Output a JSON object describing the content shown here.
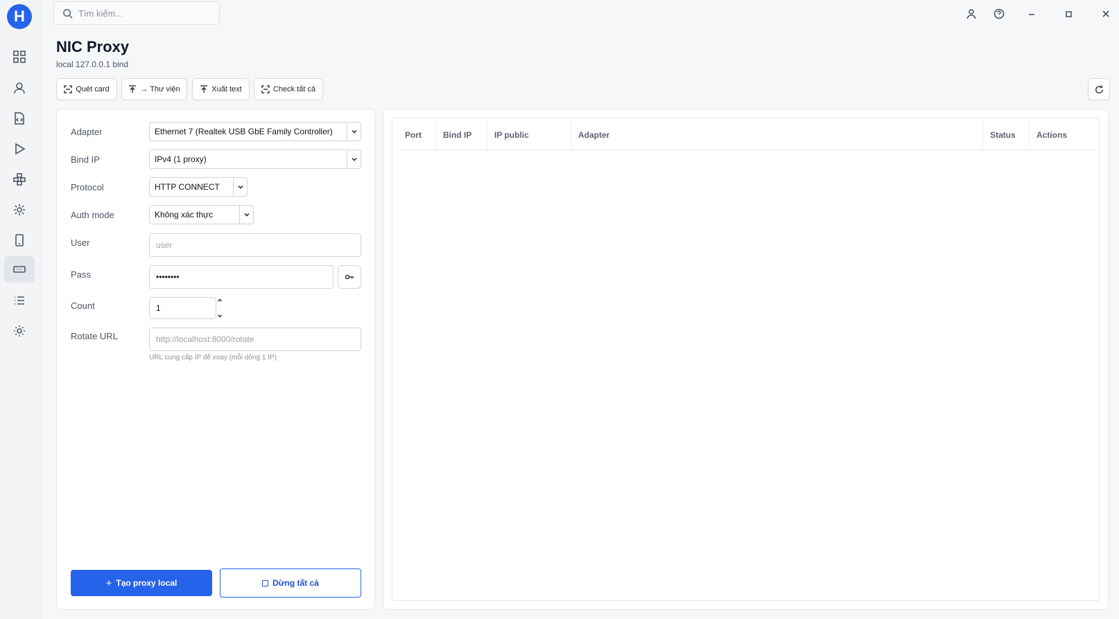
{
  "app": {
    "logo_letter": "H"
  },
  "search": {
    "placeholder": "Tìm kiếm..."
  },
  "sidebar": {
    "items": [
      {
        "icon": "dashboard-icon"
      },
      {
        "icon": "user-icon"
      },
      {
        "icon": "code-file-icon"
      },
      {
        "icon": "play-icon"
      },
      {
        "icon": "network-icon"
      },
      {
        "icon": "sun-icon"
      },
      {
        "icon": "phone-icon"
      },
      {
        "icon": "nic-card-icon",
        "active": true
      },
      {
        "icon": "list-icon"
      },
      {
        "icon": "settings-icon"
      }
    ]
  },
  "page": {
    "title": "NIC Proxy",
    "subtitle": "local 127.0.0.1 bind"
  },
  "toolbar": {
    "scan_label": "Quét card",
    "library_label": "→ Thư viện",
    "export_label": "Xuất text",
    "check_all_label": "Check tất cả"
  },
  "form": {
    "adapter_label": "Adapter",
    "adapter_value": "Ethernet 7 (Realtek USB GbE Family Controller)",
    "bind_ip_label": "Bind IP",
    "bind_ip_value": "IPv4 (1 proxy)",
    "protocol_label": "Protocol",
    "protocol_value": "HTTP CONNECT",
    "auth_mode_label": "Auth mode",
    "auth_mode_value": "Không xác thực",
    "user_label": "User",
    "user_placeholder": "user",
    "pass_label": "Pass",
    "pass_value": "••••••••",
    "count_label": "Count",
    "count_value": "1",
    "rotate_label": "Rotate URL",
    "rotate_placeholder": "http://localhost:8000/rotate",
    "rotate_hint": "URL cung cấp IP để xoay (mỗi dòng 1 IP)",
    "create_label": "Tạo proxy local",
    "stop_all_label": "Dừng tất cả"
  },
  "table": {
    "columns": [
      "Port",
      "Bind IP",
      "IP public",
      "Adapter",
      "Status",
      "Actions"
    ],
    "rows": []
  }
}
